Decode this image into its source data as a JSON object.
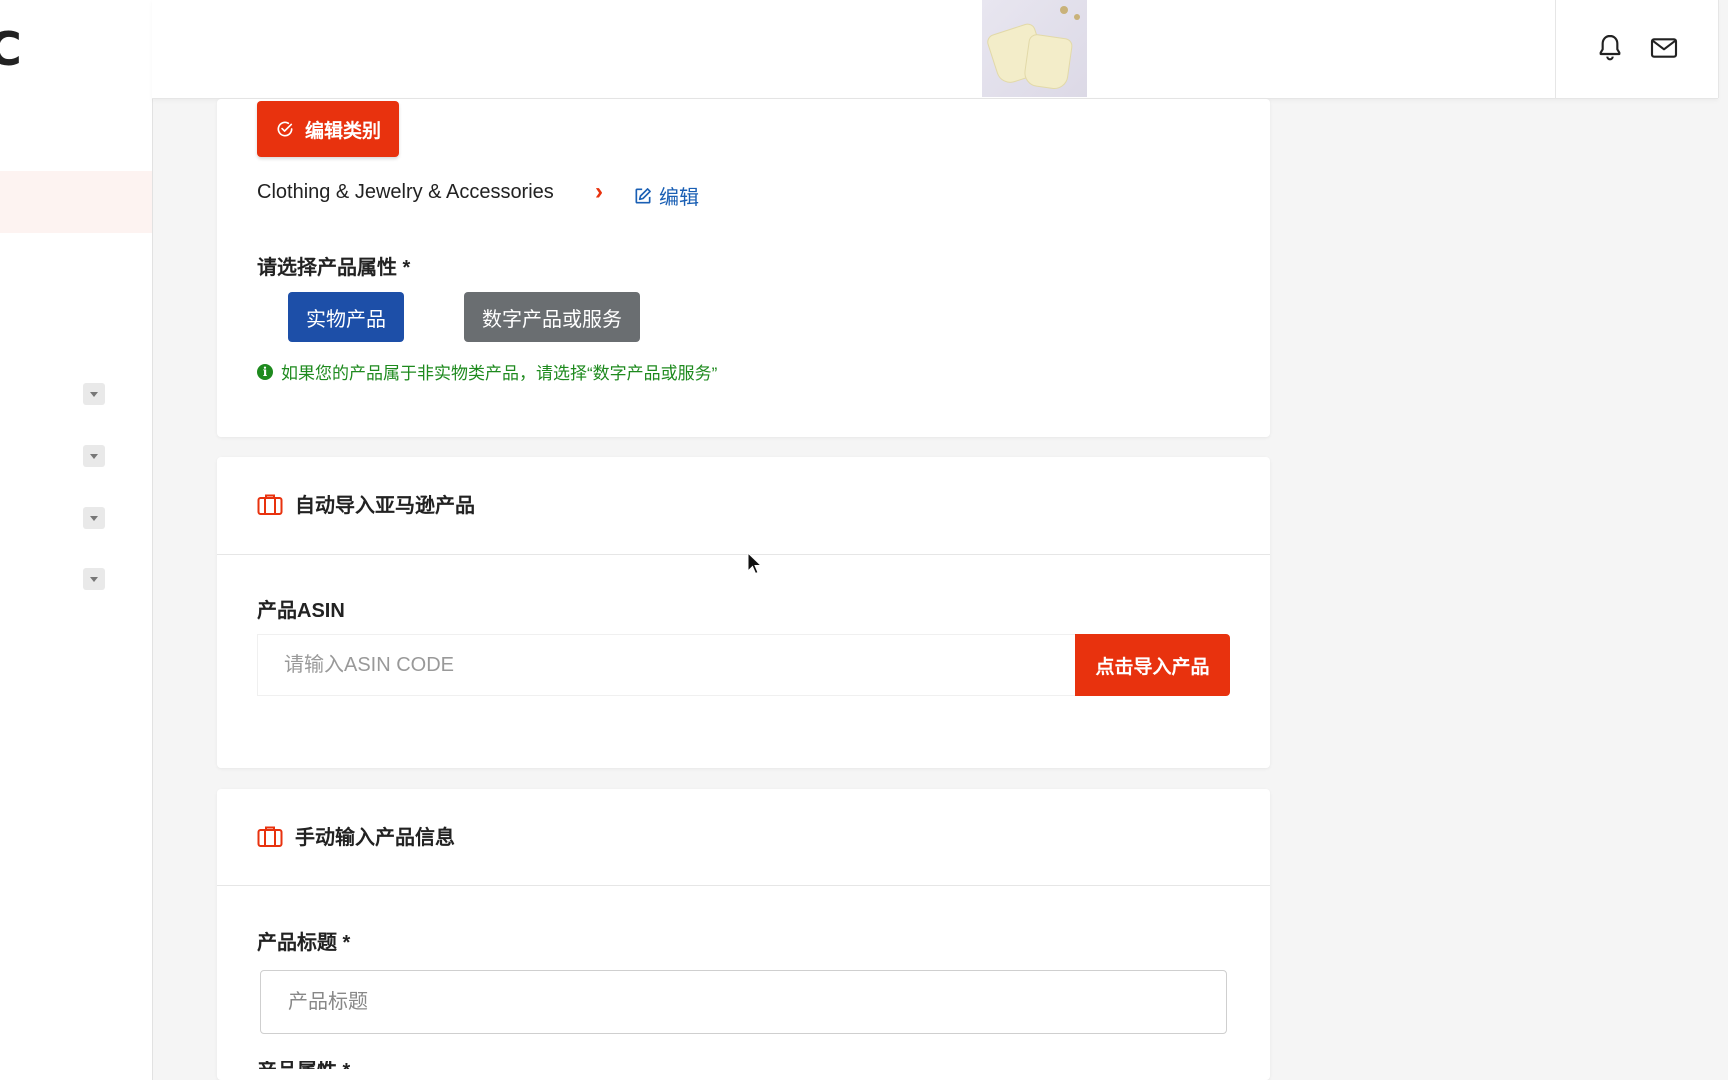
{
  "sidebar": {
    "logo": "C"
  },
  "header": {
    "icons": [
      "bell-icon",
      "mail-icon"
    ]
  },
  "category_card": {
    "edit_category_button": "编辑类别",
    "category_path": "Clothing & Jewelry & Accessories",
    "edit_link": "编辑",
    "attribute_label": "请选择产品属性 *",
    "physical_button": "实物产品",
    "digital_button": "数字产品或服务",
    "hint": "如果您的产品属于非实物类产品，请选择“数字产品或服务”"
  },
  "amazon_card": {
    "title": "自动导入亚马逊产品",
    "asin_label": "产品ASIN",
    "asin_placeholder": "请输入ASIN CODE",
    "import_button": "点击导入产品"
  },
  "manual_card": {
    "title": "手动输入产品信息",
    "product_title_label": "产品标题 *",
    "product_title_placeholder": "产品标题",
    "next_label_partial": "产品属性 *"
  },
  "colors": {
    "accent_red": "#e8320e",
    "primary_blue": "#1d4fa8",
    "secondary_gray": "#6a6e71",
    "hint_green": "#1e8a1e"
  }
}
